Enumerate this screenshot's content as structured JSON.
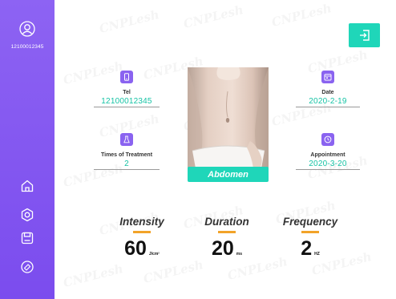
{
  "user": {
    "id": "12100012345",
    "avatar_icon": "user-circle-icon"
  },
  "sidebar": {
    "items": [
      {
        "name": "home",
        "icon": "home-icon"
      },
      {
        "name": "settings",
        "icon": "hexagon-settings-icon"
      },
      {
        "name": "save",
        "icon": "save-icon"
      },
      {
        "name": "clear",
        "icon": "eraser-icon"
      }
    ]
  },
  "header": {
    "exit_icon": "exit-icon"
  },
  "watermark": {
    "text": "CNPLesh"
  },
  "fields": {
    "tel": {
      "label": "Tel",
      "value": "12100012345",
      "icon": "phone-icon"
    },
    "date": {
      "label": "Date",
      "value": "2020-2-19",
      "icon": "calendar-icon"
    },
    "times": {
      "label": "Times of Treatment",
      "value": "2",
      "icon": "flask-icon"
    },
    "appointment": {
      "label": "Appointment",
      "value": "2020-3-20",
      "icon": "clock-icon"
    }
  },
  "treatment_area": {
    "label": "Abdomen",
    "image": "abdomen-photo"
  },
  "params": {
    "intensity": {
      "title": "Intensity",
      "value": "60",
      "unit": "J/cm²"
    },
    "duration": {
      "title": "Duration",
      "value": "20",
      "unit": "ms"
    },
    "frequency": {
      "title": "Frequency",
      "value": "2",
      "unit": "HZ"
    }
  },
  "colors": {
    "sidebar": "#7b4cee",
    "accent": "#1fd6b9",
    "value_text": "#16c3a5",
    "bar": "#f2a329",
    "icon_bg": "#8a63f0"
  }
}
